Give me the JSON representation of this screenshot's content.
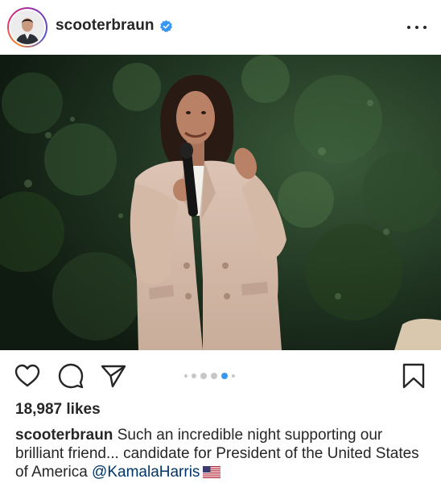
{
  "post": {
    "username": "scooterbraun",
    "verified": true,
    "likes": "18,987 likes",
    "caption_user": "scooterbraun",
    "caption_text": " Such an incredible night supporting our brilliant friend... candidate for President of the United States of America ",
    "mention": "@KamalaHarris",
    "flag_emoji": "us-flag",
    "carousel": {
      "total": 6,
      "active_index": 4
    }
  },
  "icons": {
    "more": "more-options-icon",
    "like": "heart-icon",
    "comment": "comment-icon",
    "share": "send-icon",
    "save": "bookmark-icon",
    "verified": "verified-badge-icon"
  },
  "colors": {
    "text": "#262626",
    "accent": "#3897f0",
    "mention": "#003569",
    "dot_inactive": "#c7c7c7"
  }
}
